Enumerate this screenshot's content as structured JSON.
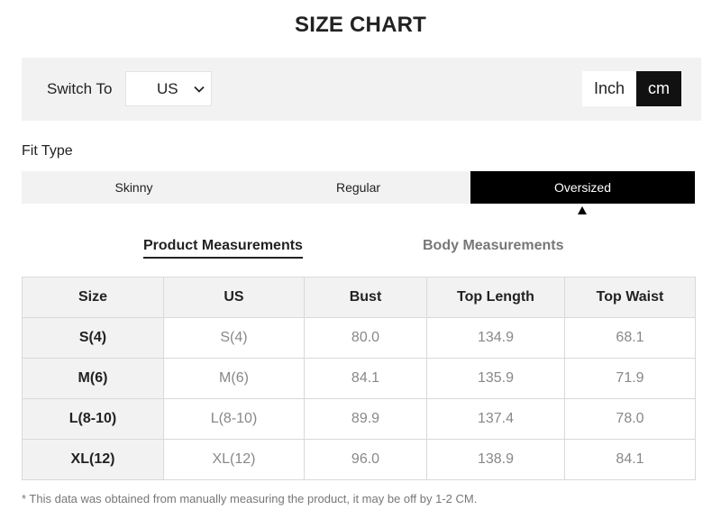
{
  "title": "SIZE CHART",
  "switch": {
    "label": "Switch To",
    "region_value": "US",
    "units": [
      {
        "label": "Inch",
        "active": false
      },
      {
        "label": "cm",
        "active": true
      }
    ]
  },
  "fit": {
    "label": "Fit Type",
    "options": [
      {
        "label": "Skinny",
        "active": false
      },
      {
        "label": "Regular",
        "active": false
      },
      {
        "label": "Oversized",
        "active": true
      }
    ]
  },
  "measure_tabs": {
    "product": "Product Measurements",
    "body": "Body Measurements",
    "active": "product"
  },
  "table": {
    "headers": [
      "Size",
      "US",
      "Bust",
      "Top Length",
      "Top Waist"
    ],
    "rows": [
      [
        "S(4)",
        "S(4)",
        "80.0",
        "134.9",
        "68.1"
      ],
      [
        "M(6)",
        "M(6)",
        "84.1",
        "135.9",
        "71.9"
      ],
      [
        "L(8-10)",
        "L(8-10)",
        "89.9",
        "137.4",
        "78.0"
      ],
      [
        "XL(12)",
        "XL(12)",
        "96.0",
        "138.9",
        "84.1"
      ]
    ]
  },
  "footnote": "* This data was obtained from manually measuring the product, it may be off by 1-2 CM.",
  "colors": {
    "active_bg": "#000000",
    "panel_bg": "#f2f2f2",
    "border": "#d9d9d9"
  }
}
